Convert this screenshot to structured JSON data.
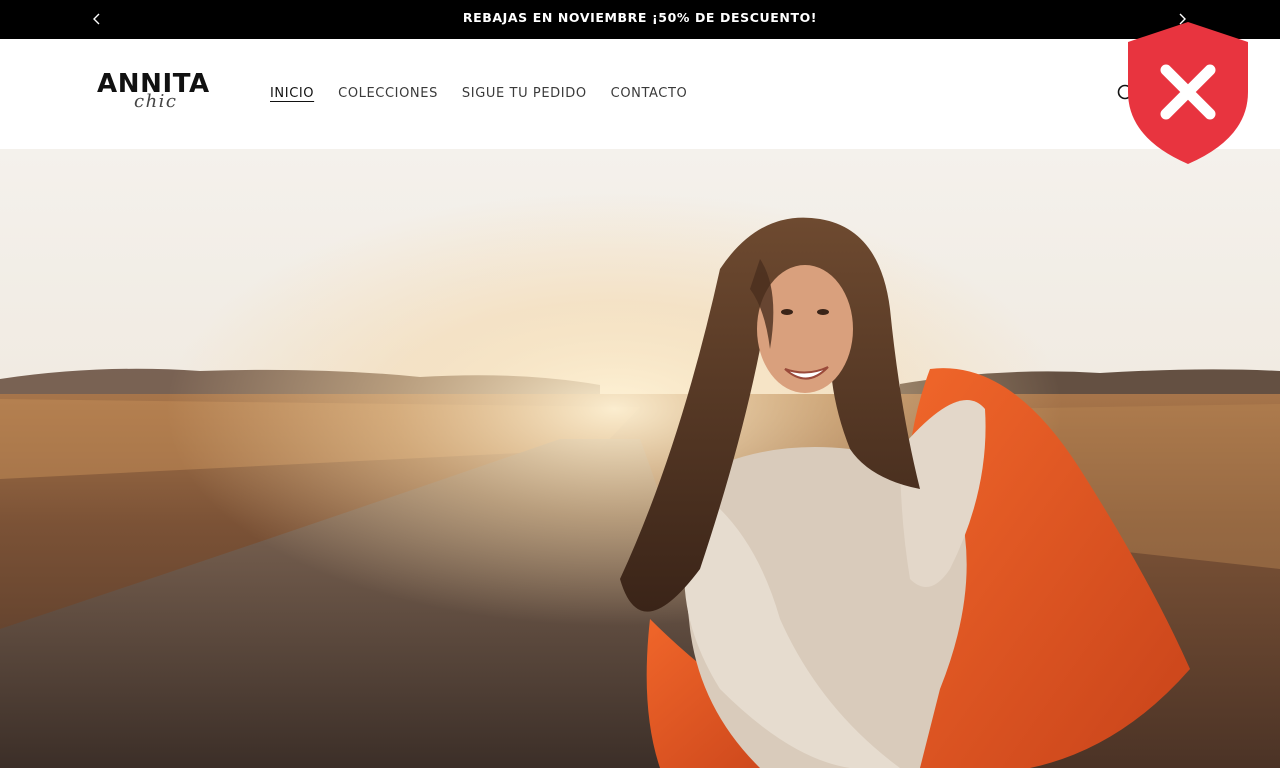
{
  "announcement": {
    "text": "REBAJAS EN NOVIEMBRE ¡50% DE DESCUENTO!",
    "prev_icon": "chevron-left-icon",
    "next_icon": "chevron-right-icon"
  },
  "header": {
    "logo": {
      "brand": "ANNITA",
      "script": "chic"
    },
    "nav": {
      "items": [
        {
          "label": "INICIO",
          "active": true
        },
        {
          "label": "COLECCIONES",
          "active": false
        },
        {
          "label": "SIGUE TU PEDIDO",
          "active": false
        },
        {
          "label": "CONTACTO",
          "active": false
        }
      ]
    },
    "search_icon": "search-icon"
  },
  "hero": {
    "image": "woman-in-field-with-orange-scarf"
  },
  "overlay": {
    "icon": "shield-close-icon",
    "color": "#e8343f"
  },
  "colors": {
    "announcement_bg": "#000000",
    "announcement_text": "#ffffff",
    "header_bg": "#ffffff",
    "text": "#121212"
  }
}
